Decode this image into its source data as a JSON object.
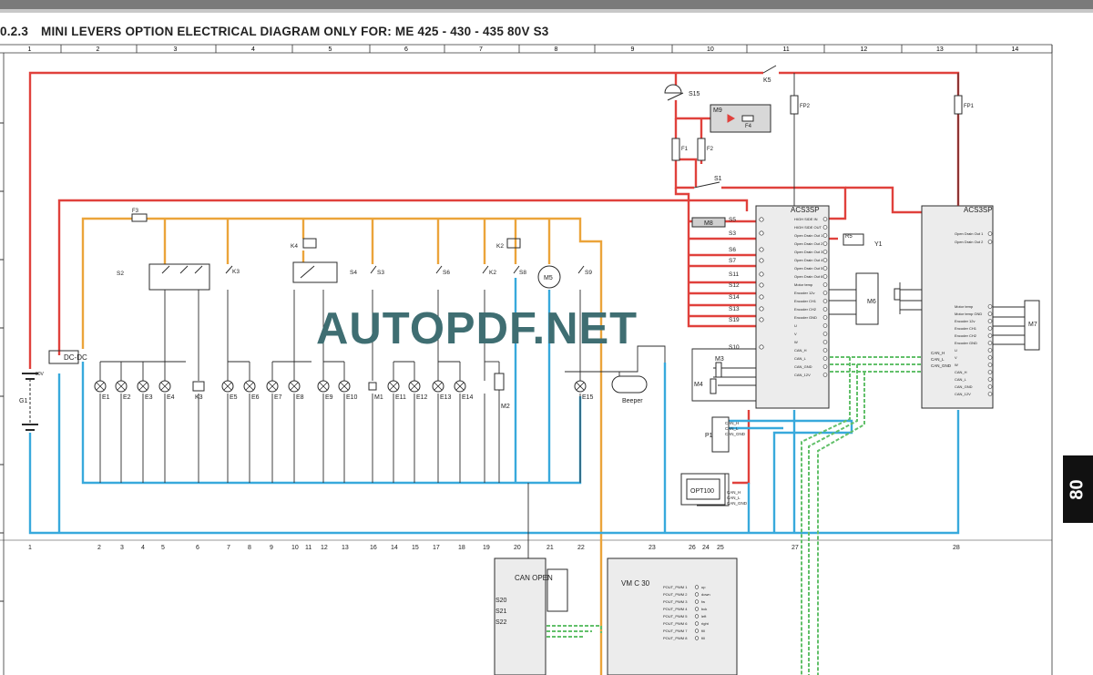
{
  "header": {
    "section": "0.2.3",
    "title": "MINI LEVERS OPTION ELECTRICAL DIAGRAM ONLY FOR: ME 425 - 430 - 435 80V S3"
  },
  "page_tab": "80",
  "watermark": "AUTOPDF.NET",
  "grid_columns": [
    "1",
    "2",
    "3",
    "4",
    "5",
    "6",
    "7",
    "8",
    "9",
    "10",
    "11",
    "12",
    "13",
    "14"
  ],
  "wire_numbers": [
    "1",
    "2",
    "3",
    "4",
    "5",
    "6",
    "7",
    "8",
    "9",
    "10",
    "11",
    "12",
    "13",
    "16",
    "14",
    "15",
    "17",
    "18",
    "19",
    "20",
    "21",
    "22",
    "23",
    "26",
    "24",
    "25",
    "27",
    "28"
  ],
  "lamps": [
    "E1",
    "E2",
    "E3",
    "E4",
    "K3",
    "E5",
    "E6",
    "E7",
    "E8",
    "E9",
    "E10",
    "M1",
    "E11",
    "E12",
    "E13",
    "E14",
    "M2",
    "E15"
  ],
  "switches": [
    "S2",
    "K3",
    "S4",
    "S3",
    "S6",
    "K2",
    "S8",
    "S9"
  ],
  "relays": [
    "K4",
    "K2"
  ],
  "fuses": [
    "F3",
    "F1",
    "F2",
    "FP2",
    "FP1",
    "F4"
  ],
  "labels": {
    "dcdc": "DC-DC",
    "battery": "G1",
    "battery_v": "80V",
    "m5": "M5",
    "beeper": "Beeper",
    "p1": "P1",
    "opt100": "OPT100",
    "k5": "K5",
    "s15": "S15",
    "s1": "S1",
    "m9": "M9",
    "m8": "M8",
    "m3": "M3",
    "m4": "M4",
    "m6": "M6",
    "m7": "M7",
    "y1": "Y1",
    "r5": "R5",
    "acs1": "ACS3SP",
    "acs2": "ACS3SP",
    "canopen": "CAN OPEN",
    "vmc30": "VM C 30",
    "s20": "S20",
    "s21": "S21",
    "s22": "S22"
  },
  "acs_left_inputs": [
    "S5",
    "S3",
    "S6",
    "S7",
    "S11",
    "S12",
    "S14",
    "S13",
    "S19",
    "S10"
  ],
  "acs_pins_left": [
    "HIGH SIDE IN",
    "HIGH SIDE OUT",
    "Open Drain Out 1",
    "Open Drain Out 2",
    "Open Drain Out 3",
    "Open Drain Out 4",
    "Open Drain Out 5",
    "Open Drain Out 6",
    "Motor temp",
    "Encoder 12v",
    "Encoder CH1",
    "Encoder CH2",
    "Encoder GND",
    "U",
    "V",
    "W",
    "CAN_H",
    "CAN_L",
    "CAN_GND",
    "CAN_12V"
  ],
  "acs_pins_right": [
    "Open Drain Out 1",
    "Open Drain Out 2",
    "Motor temp",
    "Motor temp GND",
    "Encoder 12v",
    "Encoder CH1",
    "Encoder CH2",
    "Encoder GND",
    "U",
    "V",
    "W",
    "CAN_H",
    "CAN_L",
    "CAN_GND",
    "CAN_12V"
  ],
  "canbus_labels": [
    "CAN_H",
    "CAN_L",
    "CAN_GND"
  ],
  "vmc_pins": [
    "POUT_PWM 1",
    "POUT_PWM 2",
    "POUT_PWM 3",
    "POUT_PWM 4",
    "POUT_PWM 5",
    "POUT_PWM 6",
    "POUT_PWM 7",
    "POUT_PWM 8"
  ],
  "vmc_outputs": [
    "up",
    "down",
    "fw",
    "bck",
    "left",
    "right",
    "fill",
    "fill"
  ],
  "colors": {
    "red": "#e0413c",
    "orange": "#eba43a",
    "blue": "#38a9dc",
    "green": "#62c06a",
    "ink": "#2b2b2b",
    "watermark": "#3f6e72"
  }
}
